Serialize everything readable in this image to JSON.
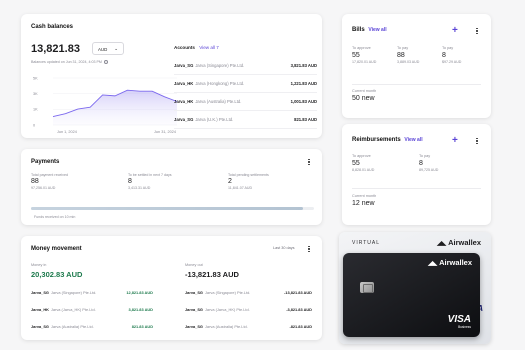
{
  "cash": {
    "title": "Cash balances",
    "total": "13,821.83",
    "currency": "AUD",
    "refreshed": "Balances updated on Jun 31, 2024, 4:03 PM",
    "chart_y_ticks": [
      "5K",
      "3K",
      "1K",
      "0"
    ],
    "chart_x_start": "Jun 1, 2024",
    "chart_x_end": "Jun 31, 2024",
    "accounts_label": "Accounts",
    "view_all": "View all 7",
    "accounts": [
      {
        "code": "Jarva_SG",
        "entity": "Jarva (Singapore) Pte.Ltd.",
        "amount": "3,821.83 AUD"
      },
      {
        "code": "Jarva_HK",
        "entity": "Jarva (Hongkong) Pte.Ltd.",
        "amount": "1,221.83 AUD"
      },
      {
        "code": "Jarva_HK",
        "entity": "Jarva (Australia) Pte.Ltd.",
        "amount": "1,001.83 AUD"
      },
      {
        "code": "Jarva_SG",
        "entity": "Jarva (U.K.) Pte.Ltd.",
        "amount": "821.83 AUD"
      }
    ]
  },
  "chart_data": {
    "type": "area",
    "x": [
      "Jun 1, 2024",
      "",
      "",
      "",
      "",
      "",
      "",
      "",
      "",
      "",
      "Jun 31, 2024"
    ],
    "values": [
      900,
      1200,
      1700,
      1900,
      3200,
      3100,
      3700,
      3600,
      3600,
      3000,
      2500
    ],
    "ylim": [
      0,
      5000
    ],
    "color": "#7b68ee"
  },
  "payments": {
    "title": "Payments",
    "stats": [
      {
        "label": "Total payment received",
        "value": "88",
        "sub": "97,256.01 AUD"
      },
      {
        "label": "To be settled in next 7 days",
        "value": "8",
        "sub": "3,413.31 AUD"
      },
      {
        "label": "Total pending settlements",
        "value": "2",
        "sub": "11,841.07 AUD"
      }
    ],
    "note": "Funds received on 10 min",
    "bar_fraction": 0.96
  },
  "movement": {
    "title": "Money movement",
    "period": "Last 30 days",
    "money_in_label": "Money in",
    "money_in": "20,302.83 AUD",
    "money_out_label": "Money out",
    "money_out": "-13,821.83 AUD",
    "in_rows": [
      {
        "code": "Jarva_SG",
        "entity": "Jarva (Singapore) Pte.Ltd.",
        "amount": "12,821.83 AUD"
      },
      {
        "code": "Jarva_HK",
        "entity": "Jarva (Jarva_HK) Pte.Ltd.",
        "amount": "3,821.83 AUD"
      },
      {
        "code": "Jarva_SG",
        "entity": "Jarva (Australia) Pte.Ltd.",
        "amount": "821.83 AUD"
      }
    ],
    "out_rows": [
      {
        "code": "Jarva_SG",
        "entity": "Jarva (Singapore) Pte.Ltd.",
        "amount": "-13,821.83 AUD"
      },
      {
        "code": "Jarva_SG",
        "entity": "Jarva (Jarva_HK) Pte.Ltd.",
        "amount": "-3,821.83 AUD"
      },
      {
        "code": "Jarva_SG",
        "entity": "Jarva (Australia) Pte.Ltd.",
        "amount": "-821.83 AUD"
      }
    ]
  },
  "bills": {
    "title": "Bills",
    "view_all": "View all",
    "cols": [
      {
        "label": "To approve",
        "value": "55",
        "sub": "17,820.01 AUD"
      },
      {
        "label": "To pay",
        "value": "88",
        "sub": "3,889.03 AUD"
      },
      {
        "label": "To pay",
        "value": "8",
        "sub": "$97.29 AUD"
      }
    ],
    "month_label": "Current month",
    "month_value": "50 new"
  },
  "reimb": {
    "title": "Reimbursements",
    "view_all": "View all",
    "cols": [
      {
        "label": "To approve",
        "value": "55",
        "sub": "8,828.01 AUD"
      },
      {
        "label": "To pay",
        "value": "8",
        "sub": "89,725 AUD"
      }
    ],
    "month_label": "Current month",
    "month_value": "12 new"
  },
  "cards": {
    "virtual_label": "VIRTUAL",
    "brand": "Airwallex",
    "network": "VISA",
    "network_sub": "Business"
  }
}
